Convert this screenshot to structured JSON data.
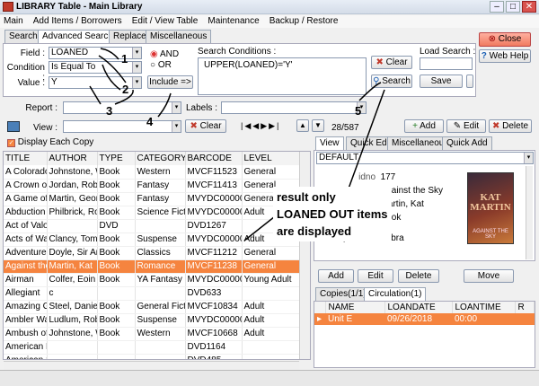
{
  "window": {
    "title": "LIBRARY Table - Main Library"
  },
  "menu": [
    "Main",
    "Add Items / Borrowers",
    "Edit / View Table",
    "Maintenance",
    "Backup / Restore"
  ],
  "tabs": [
    "Search",
    "Advanced Search",
    "Replace",
    "Miscellaneous"
  ],
  "search": {
    "field_label": "Field :",
    "field_value": "LOANED",
    "condition_label": "Condition :",
    "condition_value": "Is Equal To",
    "value_label": "Value :",
    "value_value": "Y",
    "and_label": "AND",
    "or_label": "OR",
    "include_label": "Include =>",
    "conditions_label": "Search Conditions :",
    "conditions_value": "UPPER(LOANED)='Y'",
    "clear_label": "Clear",
    "search_label": "Search",
    "load_search_label": "Load Search :",
    "save_label": "Save"
  },
  "top_buttons": {
    "close_label": "Close",
    "webhelp_label": "Web Help"
  },
  "filters": {
    "report_label": "Report :",
    "labels_label": "Labels :",
    "view_label": "View :",
    "clear_label": "Clear",
    "record_count": "28/587",
    "add_label": "Add",
    "edit_label": "Edit",
    "delete_label": "Delete"
  },
  "display_each_copy": "Display Each Copy",
  "grid": {
    "columns": [
      "TITLE",
      "AUTHOR",
      "TYPE",
      "CATEGORY",
      "BARCODE",
      "LEVEL"
    ],
    "rows": [
      [
        "A Colorado",
        "Johnstone, W",
        "Book",
        "Western",
        "MVCF11523",
        "General"
      ],
      [
        "A Crown of",
        "Jordan, Robe",
        "Book",
        "Fantasy",
        "MVCF11413",
        "General"
      ],
      [
        "A Game of",
        "Martin, Georg",
        "Book",
        "Fantasy",
        "MVYDC000007",
        "General"
      ],
      [
        "Abduction",
        "Philbrick, Rodn",
        "Book",
        "Science Fiction",
        "MVYDC000003",
        "Adult"
      ],
      [
        "Act of Valor",
        "",
        "DVD",
        "",
        "DVD1267",
        ""
      ],
      [
        "Acts of Wa",
        "Clancy, Tom",
        "Book",
        "Suspense",
        "MVYDC000007",
        "Adult"
      ],
      [
        "Adventures",
        "Doyle, Sir Artl",
        "Book",
        "Classics",
        "MVCF11212",
        "General"
      ],
      [
        "Against the",
        "Martin, Kat",
        "Book",
        "Romance",
        "MVCF11238",
        "General"
      ],
      [
        "Airman",
        "Colfer, Eoin",
        "Book",
        "YA Fantasy",
        "MVYDC000006",
        "Young Adult"
      ],
      [
        "Allegiant",
        "c",
        "",
        "",
        "DVD633",
        ""
      ],
      [
        "Amazing Gr",
        "Steel, Daniell",
        "Book",
        "General Fiction",
        "MVCF10834",
        "Adult"
      ],
      [
        "Ambler Wa",
        "Ludlum, Robe",
        "Book",
        "Suspense",
        "MVYDC000006",
        "Adult"
      ],
      [
        "Ambush of",
        "Johnstone, W",
        "Book",
        "Western",
        "MVCF10668",
        "Adult"
      ],
      [
        "American M",
        "",
        "",
        "",
        "DVD1164",
        ""
      ],
      [
        "American S",
        "",
        "",
        "",
        "DVD485",
        ""
      ]
    ],
    "selected_index": 7
  },
  "detail": {
    "tabs": [
      "View",
      "Quick Edit",
      "Miscellaneous",
      "Quick Add"
    ],
    "preset": "DEFAULT",
    "fields": [
      {
        "label": "idno",
        "value": "177"
      },
      {
        "label": "",
        "value": "Against the Sky"
      },
      {
        "label": "",
        "value": "Martin, Kat"
      },
      {
        "label": "",
        "value": "Book"
      },
      {
        "label": "publisher",
        "value": "Zebra"
      }
    ],
    "cover_author": "KAT MARTIN",
    "cover_title": "AGAINST THE SKY",
    "buttons": [
      "Add",
      "Edit",
      "Delete",
      "Move"
    ]
  },
  "circulation": {
    "tabs": [
      "Copies(1/1)",
      "Circulation(1)"
    ],
    "columns": [
      "NAME",
      "LOANDATE",
      "LOANTIME",
      "R"
    ],
    "rows": [
      [
        "Unit E",
        "09/26/2018",
        "00:00",
        ""
      ]
    ]
  },
  "annotations": {
    "numbers": [
      "1",
      "2",
      "3",
      "4",
      "5"
    ],
    "overlay_lines": [
      "result only",
      "LOANED OUT items",
      "are displayed"
    ]
  },
  "colors": {
    "selection": "#f5843f",
    "close_button": "#f07a60",
    "annotation": "#000000"
  }
}
